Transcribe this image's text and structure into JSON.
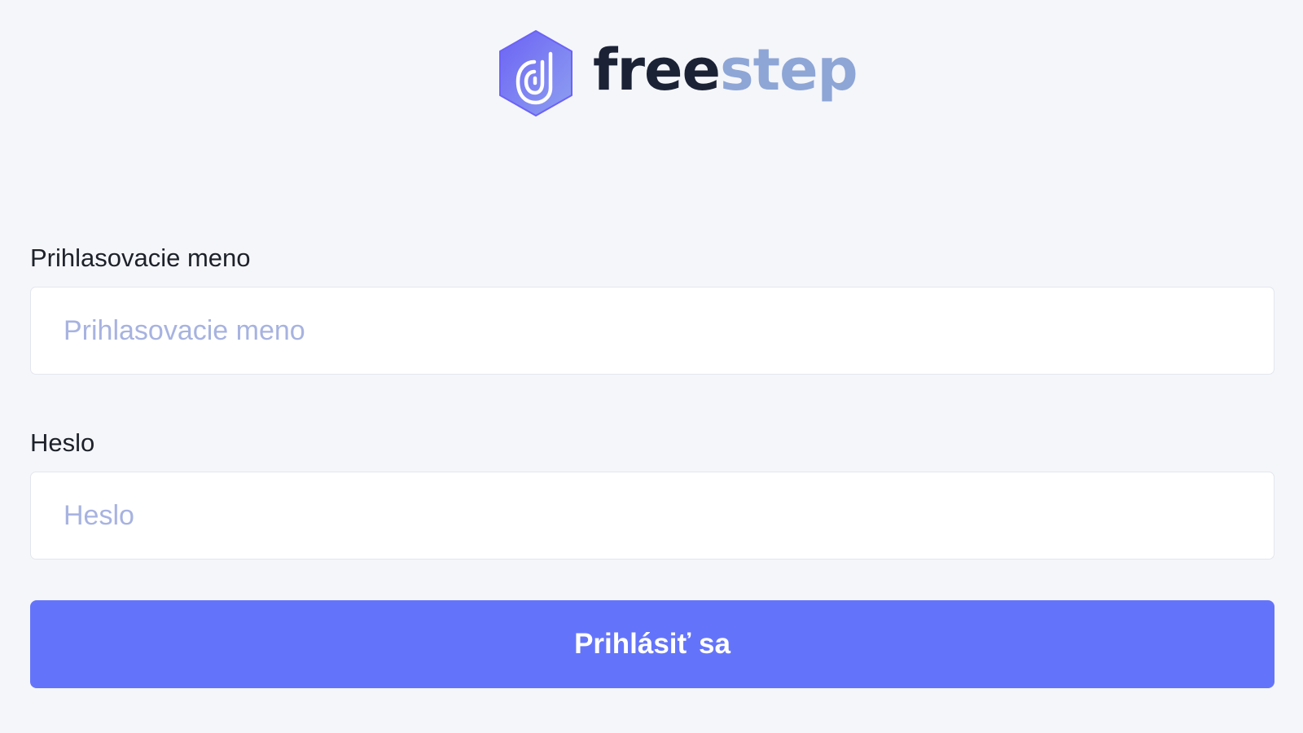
{
  "brand": {
    "name_part1": "free",
    "name_part2": "step",
    "logo_icon": "freestep-hexagon-logo-icon",
    "colors": {
      "dark": "#1c2236",
      "light": "#8ea6d6",
      "logo_gradient_start": "#6c63f5",
      "logo_gradient_end": "#8ea0f0"
    }
  },
  "login_form": {
    "username": {
      "label": "Prihlasovacie meno",
      "placeholder": "Prihlasovacie meno",
      "value": ""
    },
    "password": {
      "label": "Heslo",
      "placeholder": "Heslo",
      "value": ""
    },
    "submit_label": "Prihlásiť sa"
  },
  "colors": {
    "background": "#f5f6fa",
    "accent": "#6474fa",
    "placeholder": "#a7b3e0",
    "label_text": "#1d2129"
  }
}
